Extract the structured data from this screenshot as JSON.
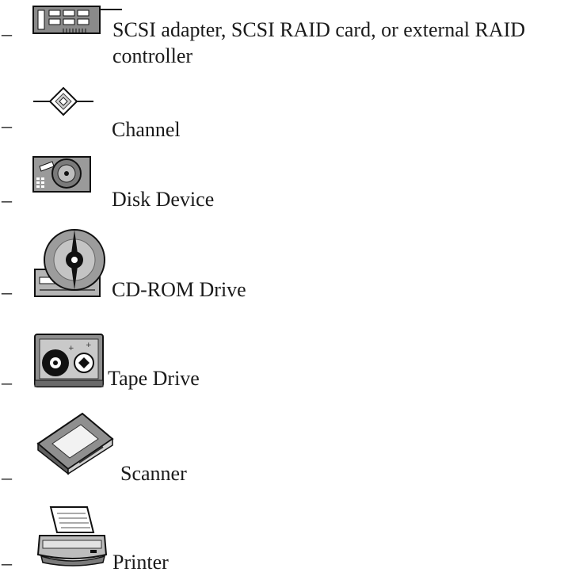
{
  "list_bullet": "–",
  "items": [
    {
      "icon": "scsi-adapter-icon",
      "label_line1": "SCSI adapter, SCSI RAID card, or external RAID",
      "label_line2": "controller"
    },
    {
      "icon": "channel-icon",
      "label": "Channel"
    },
    {
      "icon": "disk-device-icon",
      "label": "Disk Device"
    },
    {
      "icon": "cd-rom-drive-icon",
      "label": "CD-ROM Drive"
    },
    {
      "icon": "tape-drive-icon",
      "label": "Tape Drive"
    },
    {
      "icon": "scanner-icon",
      "label": "Scanner"
    },
    {
      "icon": "printer-icon",
      "label": "Printer"
    }
  ]
}
